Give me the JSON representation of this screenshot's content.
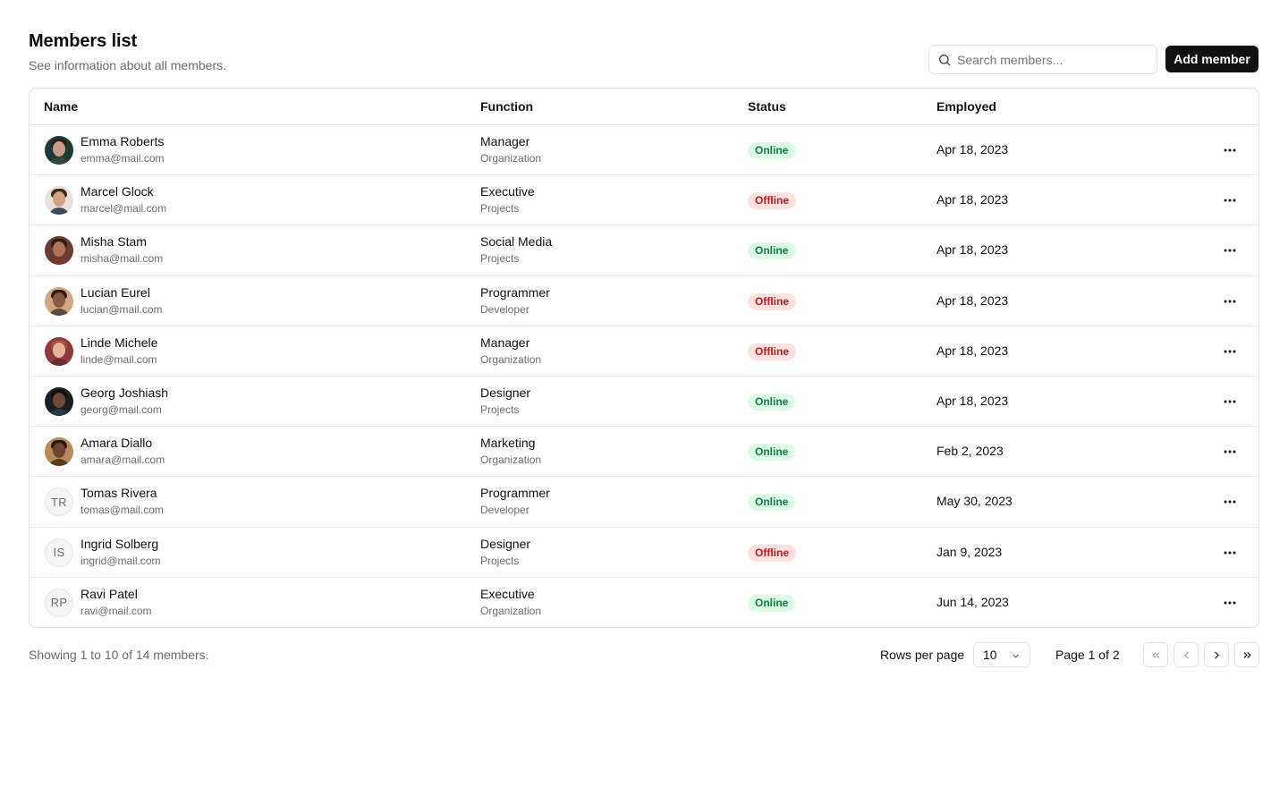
{
  "header": {
    "title": "Members list",
    "subtitle": "See information about all members.",
    "search_placeholder": "Search members...",
    "add_label": "Add member"
  },
  "table": {
    "columns": [
      "Name",
      "Function",
      "Status",
      "Employed"
    ],
    "rows": [
      {
        "name": "Emma Roberts",
        "email": "emma@mail.com",
        "function": "Manager",
        "department": "Organization",
        "status": "Online",
        "employed": "Apr 18, 2023",
        "avatar": "photo"
      },
      {
        "name": "Marcel Glock",
        "email": "marcel@mail.com",
        "function": "Executive",
        "department": "Projects",
        "status": "Offline",
        "employed": "Apr 18, 2023",
        "avatar": "photo"
      },
      {
        "name": "Misha Stam",
        "email": "misha@mail.com",
        "function": "Social Media",
        "department": "Projects",
        "status": "Online",
        "employed": "Apr 18, 2023",
        "avatar": "photo"
      },
      {
        "name": "Lucian Eurel",
        "email": "lucian@mail.com",
        "function": "Programmer",
        "department": "Developer",
        "status": "Offline",
        "employed": "Apr 18, 2023",
        "avatar": "photo"
      },
      {
        "name": "Linde Michele",
        "email": "linde@mail.com",
        "function": "Manager",
        "department": "Organization",
        "status": "Offline",
        "employed": "Apr 18, 2023",
        "avatar": "photo"
      },
      {
        "name": "Georg Joshiash",
        "email": "georg@mail.com",
        "function": "Designer",
        "department": "Projects",
        "status": "Online",
        "employed": "Apr 18, 2023",
        "avatar": "photo"
      },
      {
        "name": "Amara Diallo",
        "email": "amara@mail.com",
        "function": "Marketing",
        "department": "Organization",
        "status": "Online",
        "employed": "Feb 2, 2023",
        "avatar": "photo"
      },
      {
        "name": "Tomas Rivera",
        "email": "tomas@mail.com",
        "function": "Programmer",
        "department": "Developer",
        "status": "Online",
        "employed": "May 30, 2023",
        "avatar": "initials",
        "initials": "TR"
      },
      {
        "name": "Ingrid Solberg",
        "email": "ingrid@mail.com",
        "function": "Designer",
        "department": "Projects",
        "status": "Offline",
        "employed": "Jan 9, 2023",
        "avatar": "initials",
        "initials": "IS"
      },
      {
        "name": "Ravi Patel",
        "email": "ravi@mail.com",
        "function": "Executive",
        "department": "Organization",
        "status": "Online",
        "employed": "Jun 14, 2023",
        "avatar": "initials",
        "initials": "RP"
      }
    ]
  },
  "footer": {
    "showing": "Showing 1 to 10 of 14 members.",
    "rows_per_page_label": "Rows per page",
    "rows_per_page_value": "10",
    "page_info": "Page 1 of 2"
  },
  "colors": {
    "primary_button": "#121212",
    "online_bg": "#dcfce7",
    "online_text": "#15803d",
    "offline_bg": "#fee2e2",
    "offline_text": "#b91c1c"
  },
  "icons": {
    "search": "search-icon",
    "more": "more-horizontal-icon",
    "select": "chevron-down-icon",
    "first": "chevrons-left-icon",
    "prev": "chevron-left-icon",
    "next": "chevron-right-icon",
    "last": "chevrons-right-icon"
  }
}
